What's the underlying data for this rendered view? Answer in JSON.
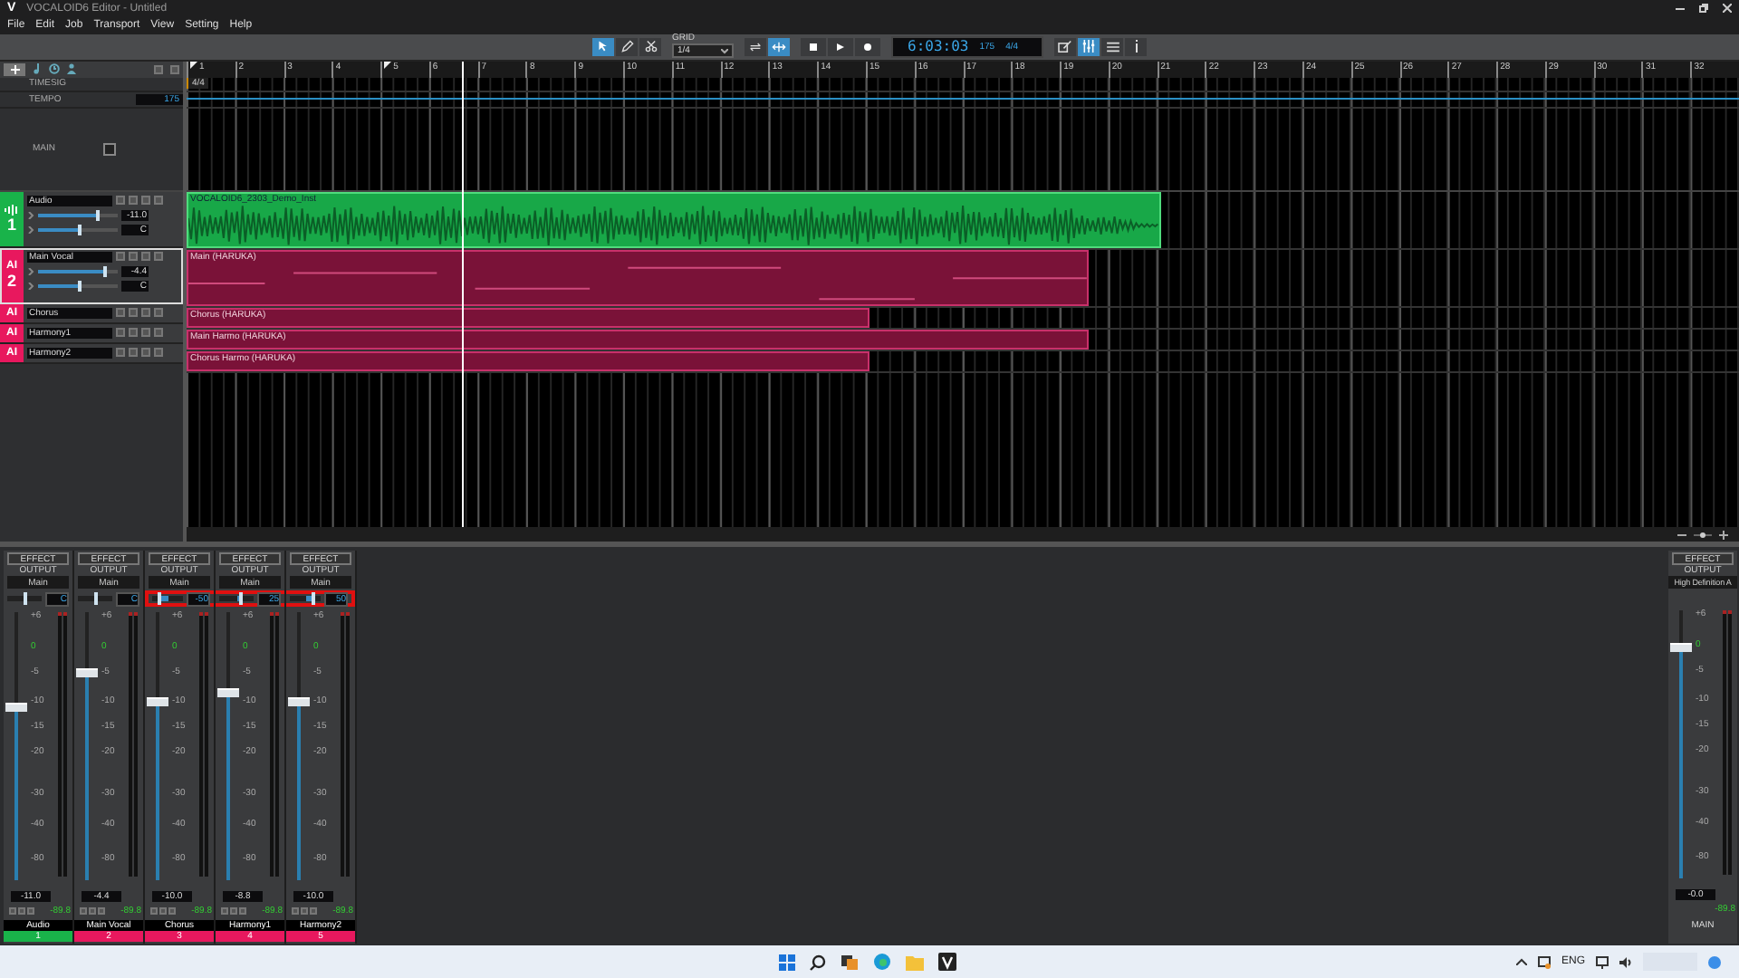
{
  "window": {
    "title": "VOCALOID6 Editor - Untitled",
    "logo": "V"
  },
  "menu": [
    "File",
    "Edit",
    "Job",
    "Transport",
    "View",
    "Setting",
    "Help"
  ],
  "toolbar": {
    "tools": [
      {
        "kind": "pointer",
        "selected": true
      },
      {
        "kind": "pencil",
        "selected": false
      },
      {
        "kind": "scissors",
        "selected": false
      }
    ],
    "grid": {
      "label": "GRID",
      "value": "1/4"
    },
    "modes": [
      {
        "kind": "loop",
        "selected": false
      },
      {
        "kind": "follow",
        "selected": true
      }
    ],
    "transport": [
      {
        "kind": "stop"
      },
      {
        "kind": "play"
      },
      {
        "kind": "record"
      }
    ],
    "display": {
      "time": "6:03:03",
      "tempo": "175",
      "timesig": "4/4"
    },
    "views": [
      {
        "kind": "edit",
        "selected": false
      },
      {
        "kind": "mixer",
        "selected": true
      },
      {
        "kind": "list",
        "selected": false
      },
      {
        "kind": "info",
        "selected": false
      }
    ]
  },
  "track_panel": {
    "timesig_label": "TIMESIG",
    "tempo_label": "TEMPO",
    "tempo": "175",
    "main_label": "MAIN",
    "main_checked": false
  },
  "ruler": {
    "bars": [
      {
        "label": "1",
        "marker": true
      },
      {
        "label": "2",
        "marker": false
      },
      {
        "label": "3",
        "marker": false
      },
      {
        "label": "4",
        "marker": false
      },
      {
        "label": "5",
        "marker": true
      },
      {
        "label": "6",
        "marker": false
      },
      {
        "label": "7",
        "marker": false
      },
      {
        "label": "8",
        "marker": false
      },
      {
        "label": "9",
        "marker": false
      },
      {
        "label": "10",
        "marker": false
      },
      {
        "label": "11",
        "marker": false
      },
      {
        "label": "12",
        "marker": false
      },
      {
        "label": "13",
        "marker": false
      },
      {
        "label": "14",
        "marker": false
      },
      {
        "label": "15",
        "marker": false
      },
      {
        "label": "16",
        "marker": false
      },
      {
        "label": "17",
        "marker": false
      },
      {
        "label": "18",
        "marker": false
      },
      {
        "label": "19",
        "marker": false
      },
      {
        "label": "20",
        "marker": false
      },
      {
        "label": "21",
        "marker": false
      },
      {
        "label": "22",
        "marker": false
      },
      {
        "label": "23",
        "marker": false
      },
      {
        "label": "24",
        "marker": false
      },
      {
        "label": "25",
        "marker": false
      },
      {
        "label": "26",
        "marker": false
      },
      {
        "label": "27",
        "marker": false
      },
      {
        "label": "28",
        "marker": false
      },
      {
        "label": "29",
        "marker": false
      },
      {
        "label": "30",
        "marker": false
      },
      {
        "label": "31",
        "marker": false
      },
      {
        "label": "32",
        "marker": false
      }
    ],
    "timesig": "4/4",
    "playhead": {
      "level": 0.177
    }
  },
  "tracks": [
    {
      "kind": "audio",
      "name": "Audio",
      "number": "1",
      "color": "#19b34a",
      "selected": false,
      "expanded": true,
      "volume": {
        "level": 0.72,
        "value": "-11.0"
      },
      "pan": {
        "level": 0.5,
        "value": "C"
      },
      "clip": {
        "label": "VOCALOID6_2303_Demo_Inst",
        "level": 0.628
      }
    },
    {
      "kind": "vocal",
      "badge": "AI",
      "name": "Main Vocal",
      "number": "2",
      "color": "#e8185e",
      "selected": true,
      "expanded": true,
      "volume": {
        "level": 0.82,
        "value": "-4.4"
      },
      "pan": {
        "level": 0.5,
        "value": "C"
      },
      "clip": {
        "label": "Main (HARUKA)",
        "level": 0.581
      }
    },
    {
      "kind": "vocal",
      "badge": "AI",
      "name": "Chorus",
      "color": "#e8185e",
      "selected": false,
      "expanded": false,
      "clip": {
        "label": "Chorus (HARUKA)",
        "level": 0.44
      }
    },
    {
      "kind": "vocal",
      "badge": "AI",
      "name": "Harmony1",
      "color": "#e8185e",
      "selected": false,
      "expanded": false,
      "clip": {
        "label": "Main Harmo (HARUKA)",
        "level": 0.581
      }
    },
    {
      "kind": "vocal",
      "badge": "AI",
      "name": "Harmony2",
      "color": "#e8185e",
      "selected": false,
      "expanded": false,
      "clip": {
        "label": "Chorus Harmo (HARUKA)",
        "level": 0.44
      }
    }
  ],
  "mixer": {
    "strips": [
      {
        "effect": "EFFECT",
        "output_label": "OUTPUT",
        "output": "Main",
        "pan": {
          "value": "C",
          "level": 0.5
        },
        "highlighted": false,
        "scale": [
          "+6",
          "0",
          "-5",
          "-10",
          "-15",
          "-20",
          "-30",
          "-40",
          "-80"
        ],
        "fader": {
          "level": 0.66,
          "value": "-11.0"
        },
        "peak": "-89.8",
        "name": "Audio",
        "number": "1",
        "color": "#19b34a"
      },
      {
        "effect": "EFFECT",
        "output_label": "OUTPUT",
        "output": "Main",
        "pan": {
          "value": "C",
          "level": 0.5
        },
        "highlighted": false,
        "scale": [
          "+6",
          "0",
          "-5",
          "-10",
          "-15",
          "-20",
          "-30",
          "-40",
          "-80"
        ],
        "fader": {
          "level": 0.79,
          "value": "-4.4"
        },
        "peak": "-89.8",
        "name": "Main Vocal",
        "number": "2",
        "color": "#e8185e"
      },
      {
        "effect": "EFFECT",
        "output_label": "OUTPUT",
        "output": "Main",
        "pan": {
          "value": "-50",
          "level": 0.25
        },
        "highlighted": true,
        "scale": [
          "+6",
          "0",
          "-5",
          "-10",
          "-15",
          "-20",
          "-30",
          "-40",
          "-80"
        ],
        "fader": {
          "level": 0.68,
          "value": "-10.0"
        },
        "peak": "-89.8",
        "name": "Chorus",
        "number": "3",
        "color": "#e8185e"
      },
      {
        "effect": "EFFECT",
        "output_label": "OUTPUT",
        "output": "Main",
        "pan": {
          "value": "25",
          "level": 0.62
        },
        "highlighted": true,
        "scale": [
          "+6",
          "0",
          "-5",
          "-10",
          "-15",
          "-20",
          "-30",
          "-40",
          "-80"
        ],
        "fader": {
          "level": 0.71,
          "value": "-8.8"
        },
        "peak": "-89.8",
        "name": "Harmony1",
        "number": "4",
        "color": "#e8185e"
      },
      {
        "effect": "EFFECT",
        "output_label": "OUTPUT",
        "output": "Main",
        "pan": {
          "value": "50",
          "level": 0.75
        },
        "highlighted": true,
        "scale": [
          "+6",
          "0",
          "-5",
          "-10",
          "-15",
          "-20",
          "-30",
          "-40",
          "-80"
        ],
        "fader": {
          "level": 0.68,
          "value": "-10.0"
        },
        "peak": "-89.8",
        "name": "Harmony2",
        "number": "5",
        "color": "#e8185e"
      }
    ],
    "master": {
      "effect": "EFFECT",
      "output_label": "OUTPUT",
      "output": "High Definition A",
      "scale": [
        "+6",
        "0",
        "-5",
        "-10",
        "-15",
        "-20",
        "-30",
        "-40",
        "-80"
      ],
      "fader": {
        "level": 0.88,
        "value": "-0.0"
      },
      "peak": "-89.8",
      "name": "MAIN"
    }
  },
  "taskbar": {
    "language": "ENG"
  }
}
